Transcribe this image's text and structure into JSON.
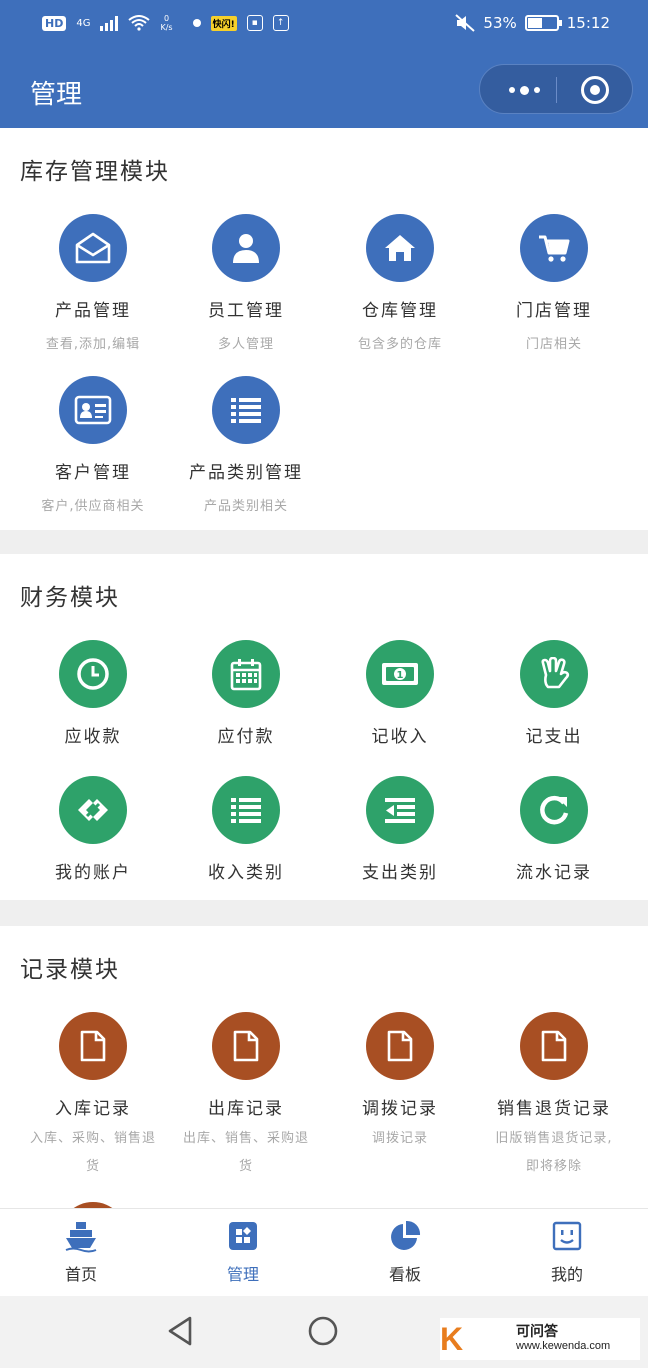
{
  "status_bar": {
    "hd": "HD",
    "network": "4G",
    "speed_value": "0",
    "speed_unit": "K/s",
    "app_tag": "快闪!",
    "battery": "53%",
    "time": "15:12"
  },
  "header": {
    "title": "管理"
  },
  "sections": {
    "inventory": {
      "title": "库存管理模块",
      "items": [
        {
          "label": "产品管理",
          "sub": "查看,添加,编辑"
        },
        {
          "label": "员工管理",
          "sub": "多人管理"
        },
        {
          "label": "仓库管理",
          "sub": "包含多的仓库"
        },
        {
          "label": "门店管理",
          "sub": "门店相关"
        },
        {
          "label": "客户管理",
          "sub": "客户,供应商相关"
        },
        {
          "label": "产品类别管理",
          "sub": "产品类别相关"
        }
      ]
    },
    "finance": {
      "title": "财务模块",
      "items": [
        {
          "label": "应收款"
        },
        {
          "label": "应付款"
        },
        {
          "label": "记收入"
        },
        {
          "label": "记支出"
        },
        {
          "label": "我的账户"
        },
        {
          "label": "收入类别"
        },
        {
          "label": "支出类别"
        },
        {
          "label": "流水记录"
        }
      ]
    },
    "records": {
      "title": "记录模块",
      "items": [
        {
          "label": "入库记录",
          "sub1": "入库、采购、销售退",
          "sub2": "货"
        },
        {
          "label": "出库记录",
          "sub1": "出库、销售、采购退",
          "sub2": "货"
        },
        {
          "label": "调拨记录",
          "sub1": "调拨记录",
          "sub2": ""
        },
        {
          "label": "销售退货记录",
          "sub1": "旧版销售退货记录,",
          "sub2": "即将移除"
        }
      ]
    }
  },
  "tabbar": {
    "items": [
      {
        "label": "首页",
        "icon": "ship-icon"
      },
      {
        "label": "管理",
        "icon": "grid-icon"
      },
      {
        "label": "看板",
        "icon": "pie-icon"
      },
      {
        "label": "我的",
        "icon": "face-icon"
      }
    ],
    "active_index": 1
  },
  "watermark": {
    "logo": "K",
    "name": "可问答",
    "url": "www.kewenda.com"
  },
  "colors": {
    "primary": "#3e6fbb",
    "finance": "#2ea26a",
    "records": "#a84f23"
  }
}
